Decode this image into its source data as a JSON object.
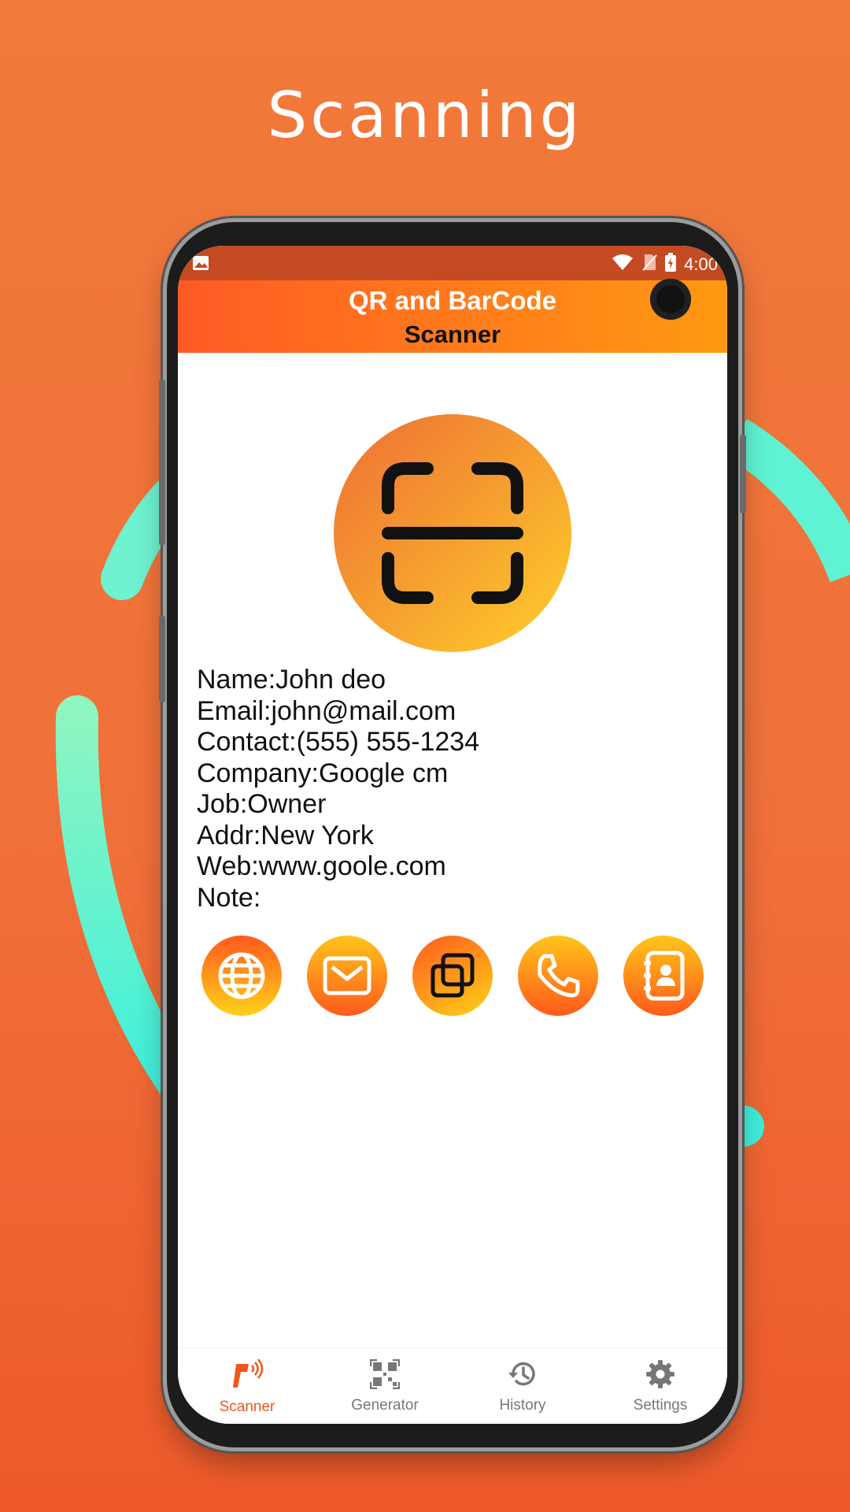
{
  "headline": "Scanning",
  "status_bar": {
    "time": "4:00"
  },
  "app_bar": {
    "title_line1": "QR and BarCode",
    "title_line2": "Scanner"
  },
  "scan_result": {
    "lines": [
      "Name:John deo",
      "Email:john@mail.com",
      "Contact:(555) 555-1234",
      "Company:Google cm",
      "Job:Owner",
      "Addr:New York",
      "Web:www.goole.com",
      "Note:"
    ]
  },
  "actions": [
    "globe-icon",
    "email-icon",
    "copy-icon",
    "phone-icon",
    "contact-book-icon"
  ],
  "bottom_nav": {
    "active": "Scanner",
    "items": [
      {
        "label": "Scanner",
        "icon": "barcode-scanner-icon"
      },
      {
        "label": "Generator",
        "icon": "qr-code-icon"
      },
      {
        "label": "History",
        "icon": "history-icon"
      },
      {
        "label": "Settings",
        "icon": "gear-icon"
      }
    ]
  },
  "colors": {
    "background": "#f27a3a",
    "appbar_start": "#ff5a25",
    "appbar_end": "#ff9a12",
    "accent_teal": "#4ff5d6",
    "status_bar": "#c44a22",
    "active_nav": "#f0561f"
  }
}
